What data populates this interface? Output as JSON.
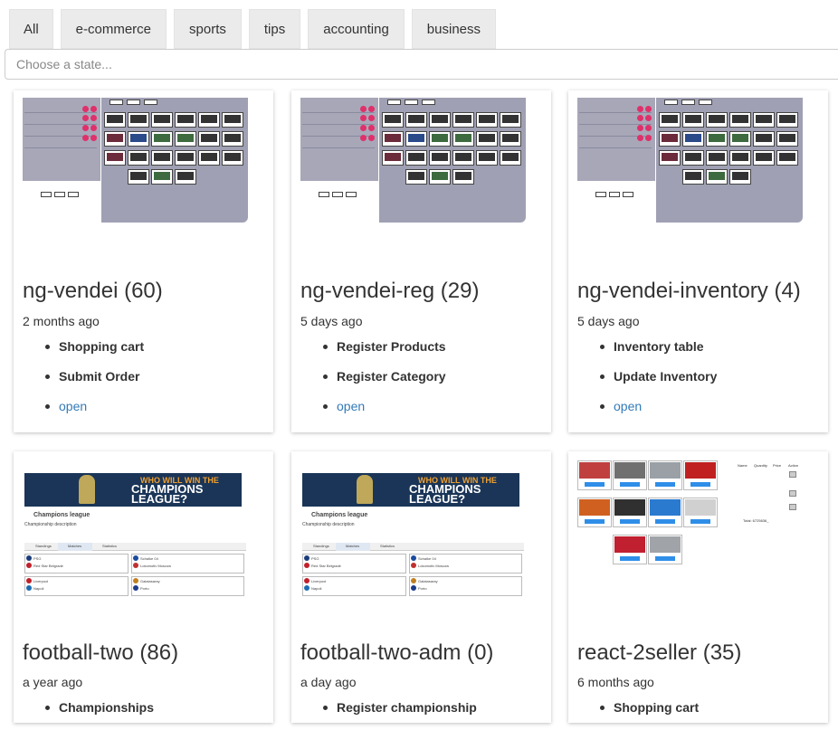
{
  "tabs": [
    "All",
    "e-commerce",
    "sports",
    "tips",
    "accounting",
    "business"
  ],
  "state_filter": {
    "placeholder": "Choose a state..."
  },
  "cards": [
    {
      "title": "ng-vendei (60)",
      "date": "2 months ago",
      "items": [
        "Shopping cart",
        "Submit Order"
      ],
      "link": "open"
    },
    {
      "title": "ng-vendei-reg (29)",
      "date": "5 days ago",
      "items": [
        "Register Products",
        "Register Category"
      ],
      "link": "open"
    },
    {
      "title": "ng-vendei-inventory (4)",
      "date": "5 days ago",
      "items": [
        "Inventory table",
        "Update Inventory"
      ],
      "link": "open"
    },
    {
      "title": "football-two (86)",
      "date": "a year ago",
      "items": [
        "Championships"
      ]
    },
    {
      "title": "football-two-adm (0)",
      "date": "a day ago",
      "items": [
        "Register championship"
      ]
    },
    {
      "title": "react-2seller (35)",
      "date": "6 months ago",
      "items": [
        "Shopping cart"
      ]
    }
  ],
  "football_thumb": {
    "banner_line1": "WHO WILL WIN THE",
    "banner_line2": "CHAMPIONS LEAGUE?",
    "heading": "Champions league",
    "description": "Championship description",
    "tab_labels": [
      "Standings",
      "Matches",
      "Statistics"
    ],
    "teams": [
      "PSG",
      "Red Star Belgrade",
      "Liverpool",
      "Napoli",
      "Schalke 04",
      "Lokomotiv Moscow",
      "Galatasaray",
      "Porto"
    ]
  },
  "react_thumb": {
    "columns": [
      "Name",
      "Quantity",
      "Price",
      "Action"
    ],
    "total": "Total: 6725636_"
  },
  "colors": {
    "link": "#337ab7",
    "tab_bg": "#ebebeb",
    "thumb_panel": "#a0a0b4",
    "accent_pink": "#e0306a"
  }
}
